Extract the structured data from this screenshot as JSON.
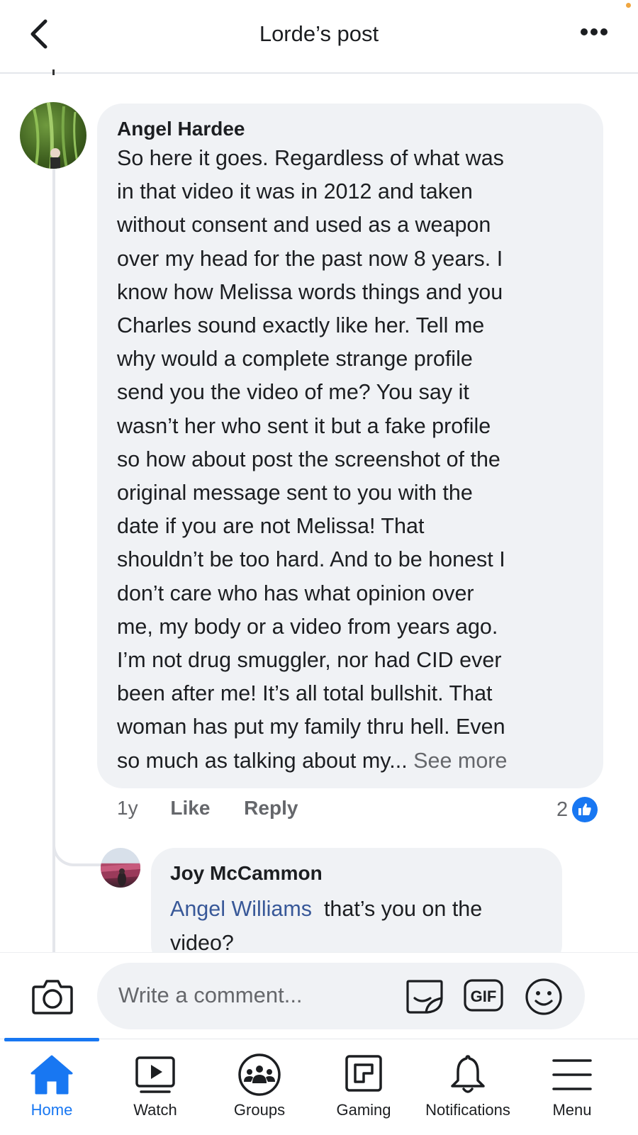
{
  "header": {
    "title": "Lorde’s post"
  },
  "comment": {
    "author": "Angel Hardee",
    "text": "So here it goes. Regardless of what was\nin that video it was in 2012 and taken\nwithout consent and used as a weapon\nover my head for the past now 8 years. I\nknow how Melissa words things and you\nCharles sound exactly like her. Tell me\nwhy would a complete strange profile\nsend you the video of me? You say it\nwasn’t her who sent it but a fake profile\nso how about post the screenshot of the\noriginal message sent to you with the\ndate if you are not Melissa! That\nshouldn’t be too hard. And to be honest I\ndon’t care who has what opinion over\nme, my body or a video from years ago.\nI’m not drug smuggler, nor had CID ever\nbeen after me! It’s all total bullshit. That\nwoman has put my family thru hell. Even\nso much as talking about my...",
    "see_more": "See more",
    "age": "1y",
    "like_label": "Like",
    "reply_label": "Reply",
    "reaction_count": "2"
  },
  "reply": {
    "author": "Joy McCammon",
    "mention": "Angel Williams",
    "text": "that’s you on the\nvideo?"
  },
  "composer": {
    "placeholder": "Write a comment..."
  },
  "nav": {
    "items": [
      {
        "label": "Home",
        "icon": "home-icon",
        "active": true
      },
      {
        "label": "Watch",
        "icon": "watch-icon"
      },
      {
        "label": "Groups",
        "icon": "groups-icon"
      },
      {
        "label": "Gaming",
        "icon": "gaming-icon"
      },
      {
        "label": "Notifications",
        "icon": "bell-icon"
      },
      {
        "label": "Menu",
        "icon": "menu-icon"
      }
    ]
  },
  "colors": {
    "accent": "#1877f2",
    "bubble": "#f0f2f5",
    "secondary_text": "#65676b",
    "mention": "#385898"
  }
}
